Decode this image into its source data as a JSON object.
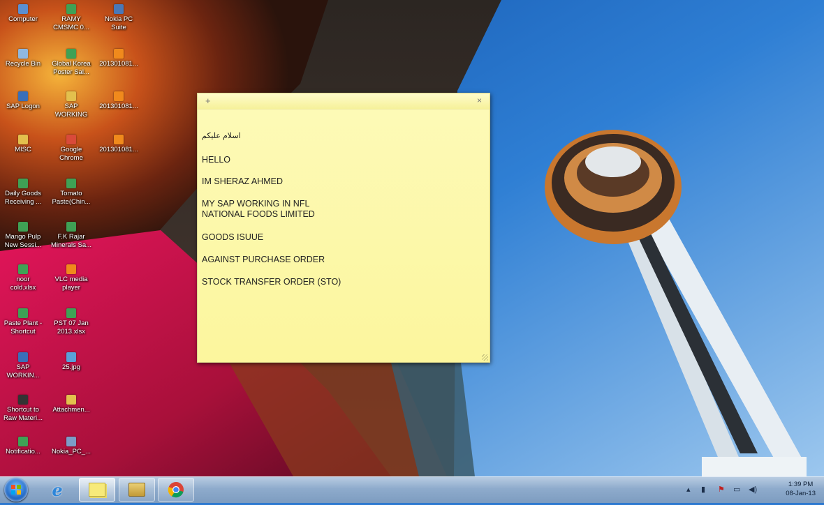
{
  "desktop": {
    "icons": [
      {
        "label": "Computer",
        "glyph": "computer-icon",
        "color": "#5b8fd1"
      },
      {
        "label": "RAMY\nCMSMC 0...",
        "glyph": "document-icon",
        "color": "#3fa155"
      },
      {
        "label": "Nokia PC\nSuite",
        "glyph": "nokia-icon",
        "color": "#4a78b8"
      },
      {
        "label": "Recycle Bin",
        "glyph": "recycle-bin-icon",
        "color": "#8fb8e0"
      },
      {
        "label": "Global Korea\nPoster Sal...",
        "glyph": "excel-icon",
        "color": "#3fa155"
      },
      {
        "label": "201301081...",
        "glyph": "vlc-icon",
        "color": "#f08a1c"
      },
      {
        "label": "SAP Logon",
        "glyph": "sap-icon",
        "color": "#3a6fb8"
      },
      {
        "label": "SAP\nWORKING",
        "glyph": "folder-icon",
        "color": "#e3c04d"
      },
      {
        "label": "201301081...",
        "glyph": "vlc-icon",
        "color": "#f08a1c"
      },
      {
        "label": "MISC",
        "glyph": "folder-icon",
        "color": "#e3c04d"
      },
      {
        "label": "Google\nChrome",
        "glyph": "chrome-icon",
        "color": "#d94a3a"
      },
      {
        "label": "201301081...",
        "glyph": "vlc-icon",
        "color": "#f08a1c"
      },
      {
        "label": "Daily Goods\nReceiving ...",
        "glyph": "excel-icon",
        "color": "#3fa155"
      },
      {
        "label": "Tomato\nPaste(Chin...",
        "glyph": "excel-icon",
        "color": "#3fa155"
      },
      {
        "label": "Mango Pulp\nNew Sessi...",
        "glyph": "excel-icon",
        "color": "#3fa155"
      },
      {
        "label": "F.K Rajar\nMinerals Sa...",
        "glyph": "excel-icon",
        "color": "#3fa155"
      },
      {
        "label": "noor\ncold.xlsx",
        "glyph": "excel-icon",
        "color": "#3fa155"
      },
      {
        "label": "VLC media\nplayer",
        "glyph": "vlc-icon",
        "color": "#f08a1c"
      },
      {
        "label": "Paste Plant -\nShortcut",
        "glyph": "excel-icon",
        "color": "#3fa155"
      },
      {
        "label": "PST 07 Jan\n2013.xlsx",
        "glyph": "excel-icon",
        "color": "#3fa155"
      },
      {
        "label": "SAP\nWORKIN...",
        "glyph": "document-icon",
        "color": "#3a6fb8"
      },
      {
        "label": "25.jpg",
        "glyph": "image-icon",
        "color": "#5aa0d8"
      },
      {
        "label": "Shortcut to\nRaw Materi...",
        "glyph": "shortcut-icon",
        "color": "#333333"
      },
      {
        "label": "Attachmen...",
        "glyph": "folder-icon",
        "color": "#e3c04d"
      },
      {
        "label": "Notificatio...",
        "glyph": "excel-icon",
        "color": "#3fa155"
      },
      {
        "label": "Nokia_PC_...",
        "glyph": "installer-icon",
        "color": "#7c9cc8"
      }
    ]
  },
  "sticky_note": {
    "add_symbol": "+",
    "close_symbol": "×",
    "lines": [
      "اسلام علیکم",
      "HELLO",
      "IM SHERAZ AHMED",
      "MY SAP WORKING IN NFL\nNATIONAL FOODS LIMITED",
      "GOODS ISUUE",
      "AGAINST PURCHASE ORDER",
      "STOCK TRANSFER ORDER (STO)"
    ]
  },
  "taskbar": {
    "apps": [
      {
        "name": "internet-explorer",
        "symbol": "e",
        "color": "#2e86d9"
      },
      {
        "name": "sticky-notes",
        "symbol": "▭",
        "color": "#e8d967"
      },
      {
        "name": "windows-explorer",
        "symbol": "▤",
        "color": "#c9a43c"
      },
      {
        "name": "google-chrome",
        "symbol": "◉",
        "color": "#d94a3a"
      }
    ],
    "tray": {
      "show_hidden": "▴",
      "time": "1:39 PM",
      "date": "08-Jan-13"
    }
  }
}
